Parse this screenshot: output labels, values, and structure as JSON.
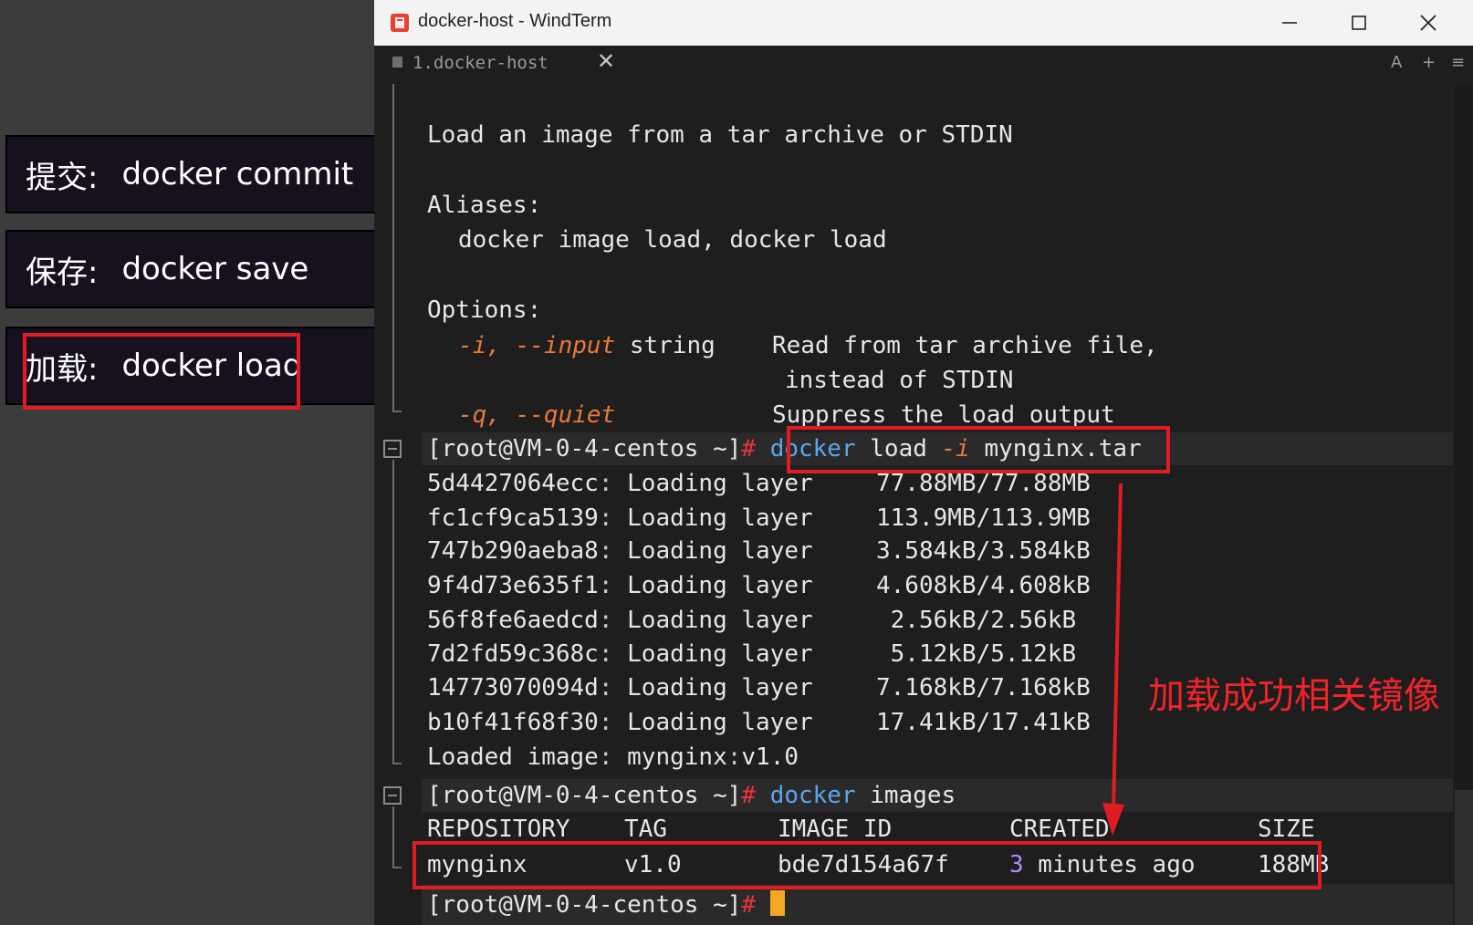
{
  "left_panel": {
    "items": [
      {
        "zh": "提交:",
        "cmd": "docker commit"
      },
      {
        "zh": "保存:",
        "cmd": "docker save"
      },
      {
        "zh": "加载:",
        "cmd": "docker load"
      }
    ]
  },
  "window": {
    "title": "docker-host - WindTerm",
    "tab_label": "1.docker-host",
    "tab_close": "✕",
    "tools": [
      "A",
      "+",
      "≡"
    ]
  },
  "terminal": {
    "help_desc": "Load an image from a tar archive or STDIN",
    "aliases_title": "Aliases:",
    "aliases": "docker image load, docker load",
    "options_title": "Options:",
    "opt1_flags": "-i, --input",
    "opt1_type": " string",
    "opt1_desc": "Read from tar archive file,",
    "opt1_desc2": "instead of STDIN",
    "opt2_flags": "-q, --quiet",
    "opt2_desc": "Suppress the load output",
    "prompt": "[root@VM-0-4-centos ~]",
    "hash": "#",
    "cmd1_docker": "docker",
    "cmd1_load": " load ",
    "cmd1_flag": "-i",
    "cmd1_arg": " mynginx.tar",
    "layers": [
      {
        "id": "5d4427064ecc",
        "status": "Loading layer",
        "progress": "77.88MB/77.88MB"
      },
      {
        "id": "fc1cf9ca5139",
        "status": "Loading layer",
        "progress": "113.9MB/113.9MB"
      },
      {
        "id": "747b290aeba8",
        "status": "Loading layer",
        "progress": "3.584kB/3.584kB"
      },
      {
        "id": "9f4d73e635f1",
        "status": "Loading layer",
        "progress": "4.608kB/4.608kB"
      },
      {
        "id": "56f8fe6aedcd",
        "status": "Loading layer",
        "progress": " 2.56kB/2.56kB"
      },
      {
        "id": "7d2fd59c368c",
        "status": "Loading layer",
        "progress": " 5.12kB/5.12kB"
      },
      {
        "id": "14773070094d",
        "status": "Loading layer",
        "progress": "7.168kB/7.168kB"
      },
      {
        "id": "b10f41f68f30",
        "status": "Loading layer",
        "progress": "17.41kB/17.41kB"
      }
    ],
    "loaded_label": "Loaded image",
    "loaded_name": " mynginx",
    "loaded_tag": "v1.0",
    "cmd2_docker": "docker",
    "cmd2_rest": " images",
    "table_headers": {
      "repo": "REPOSITORY",
      "tag": "TAG",
      "id": "IMAGE ID",
      "created": "CREATED",
      "size": "SIZE"
    },
    "table_row": {
      "repo": "mynginx",
      "tag": "v1.0",
      "id": "bde7d154a67f",
      "created_num": "3",
      "created_rest": " minutes ago",
      "size": "188MB"
    }
  },
  "annotation": "加载成功相关镜像",
  "colors": {
    "highlight": "#e11b22",
    "command": "#5aa6f0",
    "flag": "#e87a3a",
    "cursor": "#f5a623"
  }
}
